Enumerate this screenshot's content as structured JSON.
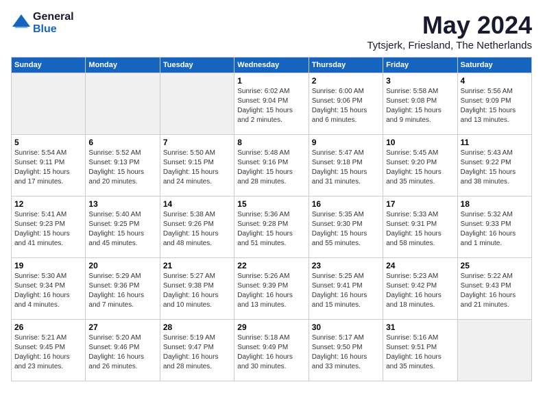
{
  "logo": {
    "general": "General",
    "blue": "Blue"
  },
  "title": {
    "month": "May 2024",
    "location": "Tytsjerk, Friesland, The Netherlands"
  },
  "days_of_week": [
    "Sunday",
    "Monday",
    "Tuesday",
    "Wednesday",
    "Thursday",
    "Friday",
    "Saturday"
  ],
  "weeks": [
    [
      {
        "day": "",
        "text": ""
      },
      {
        "day": "",
        "text": ""
      },
      {
        "day": "",
        "text": ""
      },
      {
        "day": "1",
        "text": "Sunrise: 6:02 AM\nSunset: 9:04 PM\nDaylight: 15 hours and 2 minutes."
      },
      {
        "day": "2",
        "text": "Sunrise: 6:00 AM\nSunset: 9:06 PM\nDaylight: 15 hours and 6 minutes."
      },
      {
        "day": "3",
        "text": "Sunrise: 5:58 AM\nSunset: 9:08 PM\nDaylight: 15 hours and 9 minutes."
      },
      {
        "day": "4",
        "text": "Sunrise: 5:56 AM\nSunset: 9:09 PM\nDaylight: 15 hours and 13 minutes."
      }
    ],
    [
      {
        "day": "5",
        "text": "Sunrise: 5:54 AM\nSunset: 9:11 PM\nDaylight: 15 hours and 17 minutes."
      },
      {
        "day": "6",
        "text": "Sunrise: 5:52 AM\nSunset: 9:13 PM\nDaylight: 15 hours and 20 minutes."
      },
      {
        "day": "7",
        "text": "Sunrise: 5:50 AM\nSunset: 9:15 PM\nDaylight: 15 hours and 24 minutes."
      },
      {
        "day": "8",
        "text": "Sunrise: 5:48 AM\nSunset: 9:16 PM\nDaylight: 15 hours and 28 minutes."
      },
      {
        "day": "9",
        "text": "Sunrise: 5:47 AM\nSunset: 9:18 PM\nDaylight: 15 hours and 31 minutes."
      },
      {
        "day": "10",
        "text": "Sunrise: 5:45 AM\nSunset: 9:20 PM\nDaylight: 15 hours and 35 minutes."
      },
      {
        "day": "11",
        "text": "Sunrise: 5:43 AM\nSunset: 9:22 PM\nDaylight: 15 hours and 38 minutes."
      }
    ],
    [
      {
        "day": "12",
        "text": "Sunrise: 5:41 AM\nSunset: 9:23 PM\nDaylight: 15 hours and 41 minutes."
      },
      {
        "day": "13",
        "text": "Sunrise: 5:40 AM\nSunset: 9:25 PM\nDaylight: 15 hours and 45 minutes."
      },
      {
        "day": "14",
        "text": "Sunrise: 5:38 AM\nSunset: 9:26 PM\nDaylight: 15 hours and 48 minutes."
      },
      {
        "day": "15",
        "text": "Sunrise: 5:36 AM\nSunset: 9:28 PM\nDaylight: 15 hours and 51 minutes."
      },
      {
        "day": "16",
        "text": "Sunrise: 5:35 AM\nSunset: 9:30 PM\nDaylight: 15 hours and 55 minutes."
      },
      {
        "day": "17",
        "text": "Sunrise: 5:33 AM\nSunset: 9:31 PM\nDaylight: 15 hours and 58 minutes."
      },
      {
        "day": "18",
        "text": "Sunrise: 5:32 AM\nSunset: 9:33 PM\nDaylight: 16 hours and 1 minute."
      }
    ],
    [
      {
        "day": "19",
        "text": "Sunrise: 5:30 AM\nSunset: 9:34 PM\nDaylight: 16 hours and 4 minutes."
      },
      {
        "day": "20",
        "text": "Sunrise: 5:29 AM\nSunset: 9:36 PM\nDaylight: 16 hours and 7 minutes."
      },
      {
        "day": "21",
        "text": "Sunrise: 5:27 AM\nSunset: 9:38 PM\nDaylight: 16 hours and 10 minutes."
      },
      {
        "day": "22",
        "text": "Sunrise: 5:26 AM\nSunset: 9:39 PM\nDaylight: 16 hours and 13 minutes."
      },
      {
        "day": "23",
        "text": "Sunrise: 5:25 AM\nSunset: 9:41 PM\nDaylight: 16 hours and 15 minutes."
      },
      {
        "day": "24",
        "text": "Sunrise: 5:23 AM\nSunset: 9:42 PM\nDaylight: 16 hours and 18 minutes."
      },
      {
        "day": "25",
        "text": "Sunrise: 5:22 AM\nSunset: 9:43 PM\nDaylight: 16 hours and 21 minutes."
      }
    ],
    [
      {
        "day": "26",
        "text": "Sunrise: 5:21 AM\nSunset: 9:45 PM\nDaylight: 16 hours and 23 minutes."
      },
      {
        "day": "27",
        "text": "Sunrise: 5:20 AM\nSunset: 9:46 PM\nDaylight: 16 hours and 26 minutes."
      },
      {
        "day": "28",
        "text": "Sunrise: 5:19 AM\nSunset: 9:47 PM\nDaylight: 16 hours and 28 minutes."
      },
      {
        "day": "29",
        "text": "Sunrise: 5:18 AM\nSunset: 9:49 PM\nDaylight: 16 hours and 30 minutes."
      },
      {
        "day": "30",
        "text": "Sunrise: 5:17 AM\nSunset: 9:50 PM\nDaylight: 16 hours and 33 minutes."
      },
      {
        "day": "31",
        "text": "Sunrise: 5:16 AM\nSunset: 9:51 PM\nDaylight: 16 hours and 35 minutes."
      },
      {
        "day": "",
        "text": ""
      }
    ]
  ]
}
